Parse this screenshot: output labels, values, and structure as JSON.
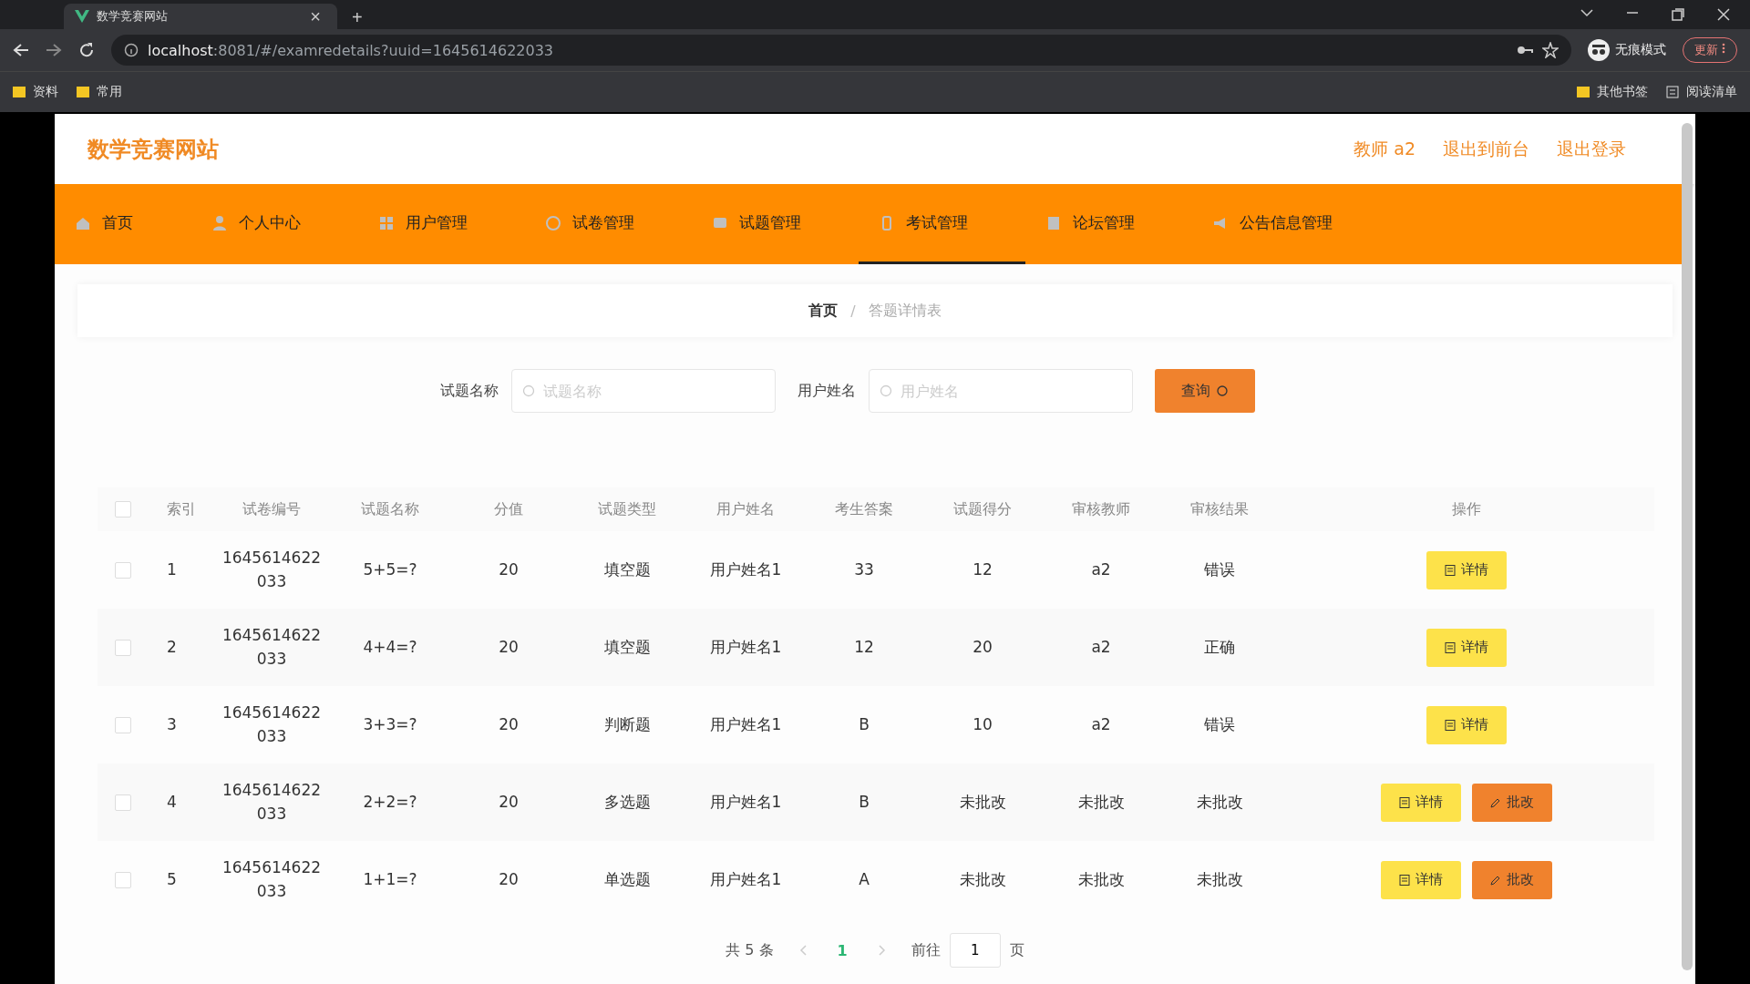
{
  "browser": {
    "tab_title": "数学竞赛网站",
    "tab_close": "×",
    "new_tab": "+",
    "url_host": "localhost",
    "url_rest": ":8081/#/examredetails?uuid=1645614622033",
    "incognito": "无痕模式",
    "update": "更新",
    "bookmarks": [
      "资料",
      "常用"
    ],
    "other_bookmarks": "其他书签",
    "reading_list": "阅读清单"
  },
  "site": {
    "title": "数学竞赛网站",
    "user_links": [
      "教师 a2",
      "退出到前台",
      "退出登录"
    ]
  },
  "nav": [
    {
      "label": "首页",
      "selected": false
    },
    {
      "label": "个人中心",
      "selected": false
    },
    {
      "label": "用户管理",
      "selected": false
    },
    {
      "label": "试卷管理",
      "selected": false
    },
    {
      "label": "试题管理",
      "selected": false
    },
    {
      "label": "考试管理",
      "selected": true
    },
    {
      "label": "论坛管理",
      "selected": false
    },
    {
      "label": "公告信息管理",
      "selected": false
    }
  ],
  "breadcrumb": {
    "home": "首页",
    "separator": "/",
    "current": "答题详情表"
  },
  "search": {
    "fields": [
      {
        "label": "试题名称",
        "placeholder": "试题名称"
      },
      {
        "label": "用户姓名",
        "placeholder": "用户姓名"
      }
    ],
    "button": "查询"
  },
  "table": {
    "columns": [
      "索引",
      "试卷编号",
      "试题名称",
      "分值",
      "试题类型",
      "用户姓名",
      "考生答案",
      "试题得分",
      "审核教师",
      "审核结果",
      "操作"
    ],
    "all_checked": false,
    "rows": [
      {
        "checked": false,
        "cells": [
          "1",
          "1645614622\n033",
          "5+5=?",
          "20",
          "填空题",
          "用户姓名1",
          "33",
          "12",
          "a2",
          "错误"
        ],
        "actions": [
          {
            "kind": "detail",
            "label": "详情"
          }
        ]
      },
      {
        "checked": false,
        "cells": [
          "2",
          "1645614622\n033",
          "4+4=?",
          "20",
          "填空题",
          "用户姓名1",
          "12",
          "20",
          "a2",
          "正确"
        ],
        "actions": [
          {
            "kind": "detail",
            "label": "详情"
          }
        ]
      },
      {
        "checked": false,
        "cells": [
          "3",
          "1645614622\n033",
          "3+3=?",
          "20",
          "判断题",
          "用户姓名1",
          "B",
          "10",
          "a2",
          "错误"
        ],
        "actions": [
          {
            "kind": "detail",
            "label": "详情"
          }
        ]
      },
      {
        "checked": false,
        "cells": [
          "4",
          "1645614622\n033",
          "2+2=?",
          "20",
          "多选题",
          "用户姓名1",
          "B",
          "未批改",
          "未批改",
          "未批改"
        ],
        "actions": [
          {
            "kind": "detail",
            "label": "详情"
          },
          {
            "kind": "grade",
            "label": "批改"
          }
        ]
      },
      {
        "checked": false,
        "cells": [
          "5",
          "1645614622\n033",
          "1+1=?",
          "20",
          "单选题",
          "用户姓名1",
          "A",
          "未批改",
          "未批改",
          "未批改"
        ],
        "actions": [
          {
            "kind": "detail",
            "label": "详情"
          },
          {
            "kind": "grade",
            "label": "批改"
          }
        ]
      }
    ]
  },
  "pagination": {
    "total": "共 5 条",
    "pages": [
      {
        "label": "1",
        "selected": true
      }
    ],
    "goto_label": "前往",
    "goto_value": "1",
    "goto_suffix": "页"
  }
}
